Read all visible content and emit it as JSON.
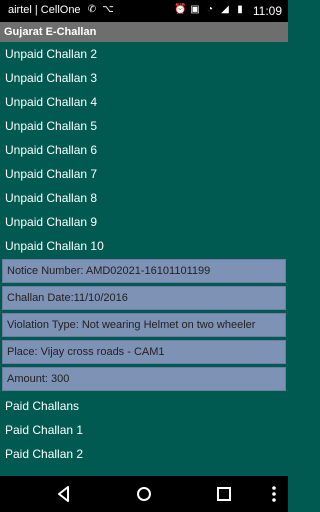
{
  "status_bar": {
    "carrier": "airtel | CellOne",
    "time": "11:09"
  },
  "app": {
    "title": "Gujarat E-Challan"
  },
  "unpaid": [
    "Unpaid Challan 2",
    "Unpaid Challan 3",
    "Unpaid Challan 4",
    "Unpaid Challan 5",
    "Unpaid Challan 6",
    "Unpaid Challan 7",
    "Unpaid Challan 8",
    "Unpaid Challan 9",
    "Unpaid Challan 10"
  ],
  "details": [
    "Notice Number: AMD02021-16101101199",
    "Challan Date:11/10/2016",
    "Violation Type: Not wearing Helmet on two wheeler",
    "Place: Vijay cross roads - CAM1",
    "Amount:  300"
  ],
  "paid": {
    "header": "Paid Challans",
    "items": [
      "Paid Challan 1",
      "Paid Challan 2"
    ]
  },
  "icons": {
    "nav": [
      "back-icon",
      "home-icon",
      "recents-icon",
      "more-icon"
    ]
  }
}
